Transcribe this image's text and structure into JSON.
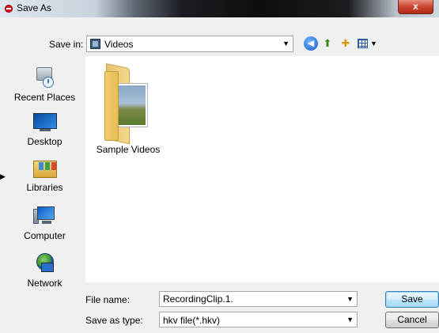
{
  "window": {
    "title": "Save As",
    "close_label": "x"
  },
  "toolbar": {
    "save_in_label": "Save in:",
    "save_in_value": "Videos",
    "back_icon": "back-arrow-icon",
    "up_icon": "up-folder-icon",
    "new_folder_icon": "new-folder-icon",
    "view_menu_icon": "view-menu-icon"
  },
  "places": {
    "items": [
      {
        "label": "Recent Places",
        "icon": "recent-places-icon"
      },
      {
        "label": "Desktop",
        "icon": "desktop-icon"
      },
      {
        "label": "Libraries",
        "icon": "libraries-icon"
      },
      {
        "label": "Computer",
        "icon": "computer-icon"
      },
      {
        "label": "Network",
        "icon": "network-icon"
      }
    ]
  },
  "files": {
    "items": [
      {
        "name": "Sample Videos",
        "type": "folder"
      }
    ]
  },
  "form": {
    "file_name_label": "File name:",
    "file_name_value": "RecordingClip.1.",
    "save_as_type_label": "Save as type:",
    "save_as_type_value": "hkv file(*.hkv)"
  },
  "buttons": {
    "save": "Save",
    "cancel": "Cancel"
  },
  "colors": {
    "accent": "#3c7fb1",
    "close": "#c9452f",
    "folder": "#f2cd72"
  }
}
